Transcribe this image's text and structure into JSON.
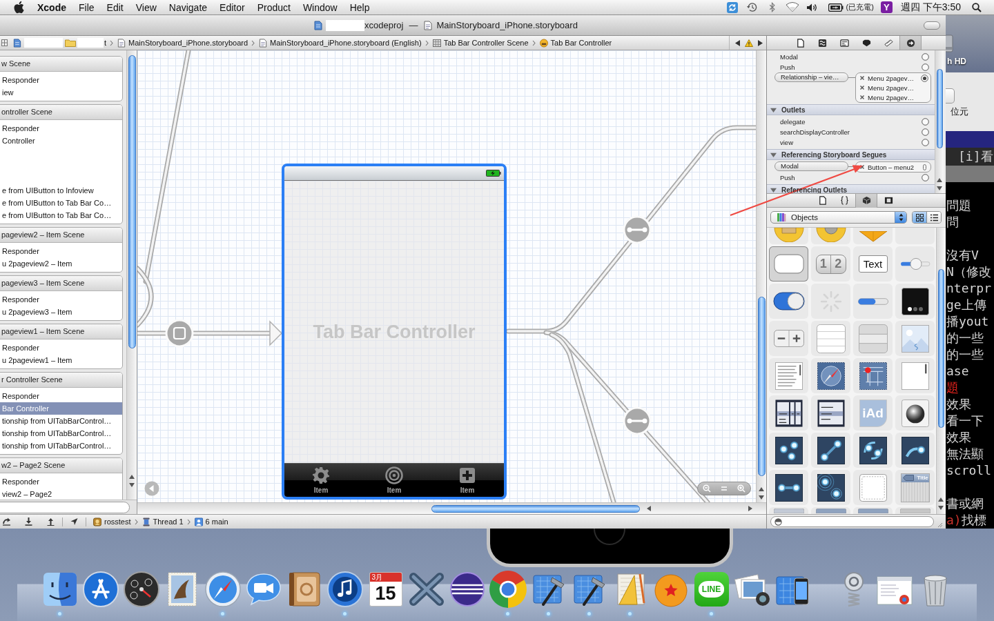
{
  "menu_bar": {
    "app_name": "Xcode",
    "menus": [
      "File",
      "Edit",
      "View",
      "Navigate",
      "Editor",
      "Product",
      "Window",
      "Help"
    ],
    "battery_note": "(已充電)",
    "status_badge": "Y",
    "clock": "週四 下午3:50"
  },
  "window": {
    "project_title": "xcodeproj",
    "separator": "—",
    "document_title": "MainStoryboard_iPhone.storyboard"
  },
  "jump_bar": {
    "crumbs": [
      {
        "kind": "project",
        "label": "t"
      },
      {
        "kind": "storyboard",
        "label": "MainStoryboard_iPhone.storyboard"
      },
      {
        "kind": "storyboard",
        "label": "MainStoryboard_iPhone.storyboard (English)"
      },
      {
        "kind": "scene",
        "label": "Tab Bar Controller Scene"
      },
      {
        "kind": "controller",
        "label": "Tab Bar Controller"
      }
    ]
  },
  "inspector_tabs": [
    {
      "kind": "file",
      "selected": false
    },
    {
      "kind": "quick-help",
      "selected": false
    },
    {
      "kind": "identity",
      "selected": false
    },
    {
      "kind": "attributes",
      "selected": false
    },
    {
      "kind": "size",
      "selected": false
    },
    {
      "kind": "connections",
      "selected": true
    }
  ],
  "navigator": {
    "scenes": [
      {
        "title": "w Scene",
        "items": [
          {
            "label": "Responder",
            "selected": false
          },
          {
            "label": "iew",
            "selected": false
          }
        ]
      },
      {
        "title": "ontroller Scene",
        "items": [
          {
            "kind": "row",
            "label": "Responder",
            "selected": false
          },
          {
            "kind": "row",
            "label": "Controller",
            "selected": false
          },
          {
            "kind": "clipped"
          },
          {
            "kind": "clipped"
          },
          {
            "kind": "clipped"
          },
          {
            "kind": "row",
            "label": "e from UIButton to Infoview",
            "selected": false
          },
          {
            "kind": "row",
            "label": "e from UIButton to Tab Bar Co…",
            "selected": false
          },
          {
            "kind": "row",
            "label": "e from UIButton to Tab Bar Co…",
            "selected": false
          }
        ]
      },
      {
        "title": "pageview2 – Item Scene",
        "items": [
          {
            "label": "Responder",
            "selected": false
          },
          {
            "label": "u 2pageview2 – Item",
            "selected": false
          }
        ]
      },
      {
        "title": "pageview3 – Item Scene",
        "items": [
          {
            "label": "Responder",
            "selected": false
          },
          {
            "label": "u 2pageview3 – Item",
            "selected": false
          }
        ]
      },
      {
        "title": "pageview1 – Item Scene",
        "items": [
          {
            "label": "Responder",
            "selected": false
          },
          {
            "label": "u 2pageview1 – Item",
            "selected": false
          }
        ]
      },
      {
        "title": "r Controller Scene",
        "items": [
          {
            "label": "Responder",
            "selected": false
          },
          {
            "label": "Bar Controller",
            "selected": true
          },
          {
            "label": "tionship from UITabBarControl…",
            "selected": false
          },
          {
            "label": "tionship from UITabBarControl…",
            "selected": false
          },
          {
            "label": "tionship from UITabBarControl…",
            "selected": false
          }
        ]
      },
      {
        "title": "w2 – Page2 Scene",
        "items": [
          {
            "label": "Responder",
            "selected": false
          },
          {
            "label": "view2 – Page2",
            "selected": false
          }
        ]
      }
    ]
  },
  "canvas": {
    "controller": {
      "title": "Tab Bar Controller",
      "selected": true,
      "tab_items": [
        {
          "kind": "gear",
          "label": "Item"
        },
        {
          "kind": "target",
          "label": "Item"
        },
        {
          "kind": "plus",
          "label": "Item"
        }
      ]
    }
  },
  "connections": {
    "scrolled_rows": [
      {
        "label": "Modal",
        "connected": false
      },
      {
        "label": "Push",
        "connected": false
      },
      {
        "label": "Relationship – vie…",
        "connected": true,
        "kind": "relationship",
        "targets": [
          {
            "label": "Menu 2pagev…"
          },
          {
            "label": "Menu 2pagev…"
          },
          {
            "label": "Menu 2pagev…"
          }
        ]
      }
    ],
    "sections": [
      {
        "title": "Outlets",
        "expanded": true,
        "rows": [
          {
            "label": "delegate",
            "connected": false
          },
          {
            "label": "searchDisplayController",
            "connected": false
          },
          {
            "label": "view",
            "connected": false
          }
        ]
      },
      {
        "title": "Referencing Storyboard Segues",
        "expanded": true,
        "rows": [
          {
            "label": "Modal",
            "connected": true,
            "kind": "segue",
            "targets": [
              {
                "label": "Button – menu2"
              }
            ]
          },
          {
            "label": "Push",
            "connected": false
          }
        ]
      },
      {
        "title": "Referencing Outlets",
        "expanded": true
      }
    ]
  },
  "library_tabs": [
    {
      "kind": "file-templates",
      "selected": false
    },
    {
      "kind": "code-snippets",
      "selected": false
    },
    {
      "kind": "objects",
      "selected": true
    },
    {
      "kind": "media",
      "selected": false
    }
  ],
  "library": {
    "selector": "Objects",
    "view_modes": [
      {
        "kind": "grid",
        "selected": true
      },
      {
        "kind": "list",
        "selected": false
      }
    ],
    "objects": [
      {
        "kind": "view-controller",
        "selected": false
      },
      {
        "kind": "glkit-view-controller",
        "selected": false
      },
      {
        "kind": "object",
        "selected": false
      },
      {
        "kind": "label",
        "selected": false
      },
      {
        "kind": "round-rect-button",
        "selected": true
      },
      {
        "kind": "segmented-control",
        "segments": [
          "1",
          "2"
        ],
        "selected": false
      },
      {
        "kind": "text-field",
        "label": "Text",
        "selected": false
      },
      {
        "kind": "slider",
        "selected": false
      },
      {
        "kind": "switch",
        "selected": false
      },
      {
        "kind": "activity-indicator",
        "selected": false
      },
      {
        "kind": "progress-view",
        "selected": false
      },
      {
        "kind": "page-control",
        "selected": false
      },
      {
        "kind": "stepper",
        "selected": false
      },
      {
        "kind": "table-view",
        "selected": false
      },
      {
        "kind": "table-view-cell",
        "selected": false
      },
      {
        "kind": "image-view",
        "selected": false
      },
      {
        "kind": "text-view",
        "selected": false
      },
      {
        "kind": "web-view",
        "selected": false
      },
      {
        "kind": "map-view",
        "selected": false
      },
      {
        "kind": "scroll-view",
        "selected": false
      },
      {
        "kind": "date-picker",
        "selected": false
      },
      {
        "kind": "picker-view",
        "selected": false
      },
      {
        "kind": "ad-banner-view",
        "label": "iAd",
        "selected": false
      },
      {
        "kind": "glkit-view",
        "selected": false
      },
      {
        "kind": "tap-gesture",
        "selected": false
      },
      {
        "kind": "pinch-gesture",
        "selected": false
      },
      {
        "kind": "rotation-gesture",
        "selected": false
      },
      {
        "kind": "swipe-gesture",
        "selected": false
      },
      {
        "kind": "pan-gesture",
        "selected": false
      },
      {
        "kind": "long-press-gesture",
        "selected": false
      },
      {
        "kind": "view",
        "selected": false
      },
      {
        "kind": "navigation-bar",
        "label": "Title",
        "selected": false
      },
      {
        "kind": "navigation-item",
        "selected": false
      },
      {
        "kind": "toolbar",
        "selected": false
      },
      {
        "kind": "bar-button-item",
        "selected": false
      },
      {
        "kind": "fixed-space",
        "selected": false
      }
    ]
  },
  "debug_bar": {
    "crumbs": [
      {
        "kind": "app",
        "label": "rosstest"
      },
      {
        "kind": "thread",
        "label": "Thread 1"
      },
      {
        "kind": "frame",
        "label": "6 main"
      }
    ]
  },
  "background": {
    "disk_label": "h HD",
    "window_text": "位元",
    "terminal_title": "[i]看",
    "terminal_blocks": [
      {
        "lines": [
          {
            "spans": [
              {
                "text": "問題",
                "color": "#d6d6d6"
              }
            ]
          },
          {
            "spans": [
              {
                "text": "問",
                "color": "#d6d6d6"
              }
            ]
          }
        ]
      },
      {
        "lines": [
          {
            "spans": [
              {
                "text": "沒有V",
                "color": "#d6d6d6"
              }
            ]
          },
          {
            "spans": [
              {
                "text": "N（修改",
                "color": "#d6d6d6"
              }
            ]
          },
          {
            "spans": [
              {
                "text": "nterpr",
                "color": "#d6d6d6"
              }
            ]
          },
          {
            "spans": [
              {
                "text": "ge上傳",
                "color": "#d6d6d6"
              }
            ]
          },
          {
            "spans": [
              {
                "text": "播yout",
                "color": "#d6d6d6"
              }
            ]
          },
          {
            "spans": [
              {
                "text": "的一些",
                "color": "#d6d6d6"
              }
            ]
          },
          {
            "spans": [
              {
                "text": "的一些",
                "color": "#d6d6d6"
              }
            ]
          },
          {
            "spans": [
              {
                "text": "ase",
                "color": "#d6d6d6"
              }
            ]
          },
          {
            "spans": [
              {
                "text": "題",
                "color": "#e8231d"
              }
            ]
          },
          {
            "spans": [
              {
                "text": "效果",
                "color": "#d6d6d6"
              }
            ]
          },
          {
            "spans": [
              {
                "text": "看一下",
                "color": "#d6d6d6"
              }
            ]
          },
          {
            "spans": [
              {
                "text": "效果",
                "color": "#d6d6d6"
              }
            ]
          },
          {
            "spans": [
              {
                "text": "無法顯",
                "color": "#d6d6d6"
              }
            ]
          },
          {
            "spans": [
              {
                "text": "scroll",
                "color": "#d6d6d6"
              }
            ]
          }
        ]
      },
      {
        "lines": [
          {
            "spans": [
              {
                "text": "書或網",
                "color": "#d6d6d6"
              }
            ]
          },
          {
            "spans": [
              {
                "text": "a)",
                "color": "#c8322c"
              },
              {
                "text": "找標",
                "color": "#d6d6d6"
              }
            ]
          }
        ]
      }
    ]
  },
  "dock": {
    "items": [
      {
        "kind": "finder",
        "running": true
      },
      {
        "kind": "app-store",
        "running": false
      },
      {
        "kind": "dashboard",
        "running": false
      },
      {
        "kind": "mail",
        "running": false
      },
      {
        "kind": "safari",
        "running": true
      },
      {
        "kind": "video-chat",
        "running": false
      },
      {
        "kind": "address-book",
        "running": false
      },
      {
        "kind": "itunes",
        "running": true
      },
      {
        "kind": "calendar",
        "month": "3月",
        "day": "15",
        "running": false
      },
      {
        "kind": "x-app",
        "running": false
      },
      {
        "kind": "eclipse",
        "running": false
      },
      {
        "kind": "chrome",
        "running": true
      },
      {
        "kind": "xcode",
        "running": true
      },
      {
        "kind": "xcode",
        "running": true
      },
      {
        "kind": "ruler-app",
        "running": true
      },
      {
        "kind": "star-ball",
        "running": false
      },
      {
        "kind": "chat",
        "label": "LINE",
        "running": true
      },
      {
        "kind": "photos",
        "running": false
      },
      {
        "kind": "simulator",
        "running": false
      },
      {
        "kind": "separator"
      },
      {
        "kind": "spring-stack",
        "running": false
      },
      {
        "kind": "document-stack",
        "running": false
      },
      {
        "kind": "trash",
        "running": false
      }
    ]
  }
}
